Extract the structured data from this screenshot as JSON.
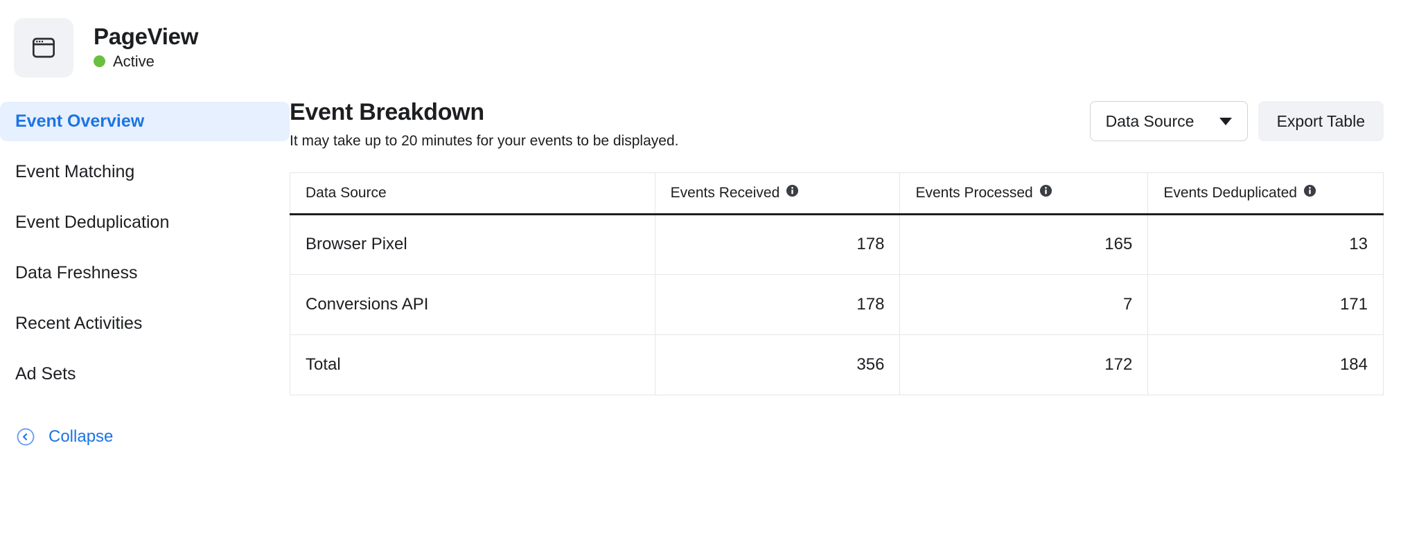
{
  "header": {
    "app_icon": "browser-window-icon",
    "title": "PageView",
    "status_label": "Active",
    "status_color": "#6abf40"
  },
  "sidebar": {
    "items": [
      {
        "label": "Event Overview",
        "active": true
      },
      {
        "label": "Event Matching",
        "active": false
      },
      {
        "label": "Event Deduplication",
        "active": false
      },
      {
        "label": "Data Freshness",
        "active": false
      },
      {
        "label": "Recent Activities",
        "active": false
      },
      {
        "label": "Ad Sets",
        "active": false
      }
    ],
    "collapse": {
      "label": "Collapse",
      "icon": "chevron-left-circle-icon",
      "color": "#1b74e4"
    },
    "active_bg": "#e7f0fe",
    "active_color": "#1b74e4"
  },
  "main": {
    "title": "Event Breakdown",
    "subtitle": "It may take up to 20 minutes for your events to be displayed.",
    "actions": {
      "data_source_label": "Data Source",
      "data_source_icon": "chevron-down-icon",
      "export_label": "Export Table"
    },
    "table": {
      "columns": [
        {
          "label": "Data Source",
          "info": false,
          "align": "left"
        },
        {
          "label": "Events Received",
          "info": true,
          "align": "right"
        },
        {
          "label": "Events Processed",
          "info": true,
          "align": "right"
        },
        {
          "label": "Events Deduplicated",
          "info": true,
          "align": "right"
        }
      ],
      "rows": [
        {
          "source": "Browser Pixel",
          "received": "178",
          "processed": "165",
          "deduplicated": "13"
        },
        {
          "source": "Conversions API",
          "received": "178",
          "processed": "7",
          "deduplicated": "171"
        },
        {
          "source": "Total",
          "received": "356",
          "processed": "172",
          "deduplicated": "184"
        }
      ]
    }
  }
}
